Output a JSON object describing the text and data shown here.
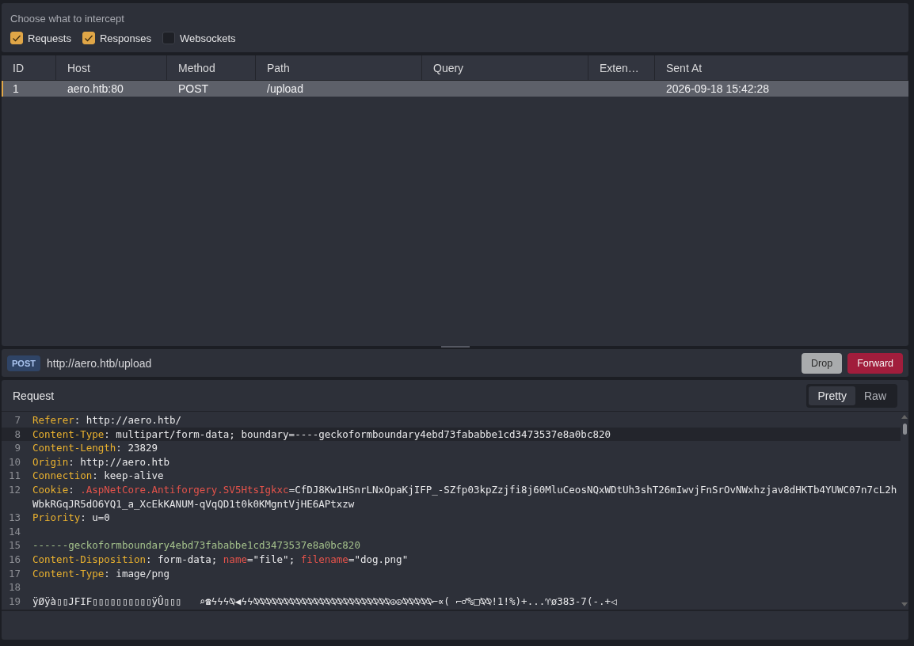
{
  "intercept": {
    "title": "Choose what to intercept",
    "options": [
      {
        "label": "Requests",
        "checked": true
      },
      {
        "label": "Responses",
        "checked": true
      },
      {
        "label": "Websockets",
        "checked": false
      }
    ]
  },
  "table": {
    "columns": [
      "ID",
      "Host",
      "Method",
      "Path",
      "Query",
      "Exten…",
      "Sent At"
    ],
    "rows": [
      {
        "selected": true,
        "cells": [
          "1",
          "aero.htb:80",
          "POST",
          "/upload",
          "",
          "",
          "2026-09-18 15:42:28"
        ]
      }
    ]
  },
  "url_bar": {
    "method": "POST",
    "url": "http://aero.htb/upload",
    "buttons": [
      {
        "label": "Drop",
        "kind": "secondary"
      },
      {
        "label": "Forward",
        "kind": "primary"
      }
    ]
  },
  "request": {
    "title": "Request",
    "tabs": [
      {
        "label": "Pretty",
        "selected": true
      },
      {
        "label": "Raw",
        "selected": false
      }
    ],
    "lines": [
      {
        "number": "7",
        "highlighted": false,
        "segments": [
          {
            "kind": "key",
            "text": "Referer"
          },
          {
            "kind": "plain",
            "text": ": http://aero.htb/"
          }
        ]
      },
      {
        "number": "8",
        "highlighted": true,
        "segments": [
          {
            "kind": "key",
            "text": "Content-Type"
          },
          {
            "kind": "plain",
            "text": ": multipart/form-data; boundary=----geckoformboundary4ebd73fababbe1cd3473537e8a0bc820"
          }
        ]
      },
      {
        "number": "9",
        "highlighted": false,
        "segments": [
          {
            "kind": "key",
            "text": "Content-Length"
          },
          {
            "kind": "plain",
            "text": ": 23829"
          }
        ]
      },
      {
        "number": "10",
        "highlighted": false,
        "segments": [
          {
            "kind": "key",
            "text": "Origin"
          },
          {
            "kind": "plain",
            "text": ": http://aero.htb"
          }
        ]
      },
      {
        "number": "11",
        "highlighted": false,
        "segments": [
          {
            "kind": "key",
            "text": "Connection"
          },
          {
            "kind": "plain",
            "text": ": keep-alive"
          }
        ]
      },
      {
        "number": "12",
        "highlighted": false,
        "segments": [
          {
            "kind": "key",
            "text": "Cookie"
          },
          {
            "kind": "plain",
            "text": ": "
          },
          {
            "kind": "attr",
            "text": ".AspNetCore.Antiforgery.SV5HtsIgkxc"
          },
          {
            "kind": "plain",
            "text": "=CfDJ8Kw1HSnrLNxOpaKjIFP_-SZfp03kpZzjfi8j60MluCeosNQxWDtUh3shT26mIwvjFnSrOvNWxhzjav8dHKTb4YUWC07n7cL2hWbkRGqJR5dO6YQ1_a_XcEkKANUM-qVqQD1t0k0KMgntVjHE6APtxzw"
          }
        ]
      },
      {
        "number": "13",
        "highlighted": false,
        "segments": [
          {
            "kind": "key",
            "text": "Priority"
          },
          {
            "kind": "plain",
            "text": ": u=0"
          }
        ]
      },
      {
        "number": "14",
        "highlighted": false
      },
      {
        "number": "15",
        "highlighted": false,
        "segments": [
          {
            "kind": "boundary",
            "text": "------geckoformboundary4ebd73fababbe1cd3473537e8a0bc820"
          }
        ]
      },
      {
        "number": "16",
        "highlighted": false,
        "segments": [
          {
            "kind": "key",
            "text": "Content-Disposition"
          },
          {
            "kind": "plain",
            "text": ": form-data; "
          },
          {
            "kind": "attr",
            "text": "name"
          },
          {
            "kind": "plain",
            "text": "=\"file\"; "
          },
          {
            "kind": "attr",
            "text": "filename"
          },
          {
            "kind": "plain",
            "text": "=\"dog.png\""
          }
        ]
      },
      {
        "number": "17",
        "highlighted": false,
        "segments": [
          {
            "kind": "key",
            "text": "Content-Type"
          },
          {
            "kind": "plain",
            "text": ": image/png"
          }
        ]
      },
      {
        "number": "18",
        "highlighted": false
      },
      {
        "number": "19",
        "highlighted": false,
        "segments": [
          {
            "kind": "plain",
            "text": "ÿØÿà▯▯JFIF▯▯▯▯▯▯▯▯▯▯ÿÛ▯▯▯   ⌕☎ϟϟϟ⍉◀ϟϟ⍉⍉⍉⍉⍉⍉⍉⍉⍉⍉⍉⍉⍉⍉⍉⍉⍉⍉⍉⍉⍉⍉⍉☮☮⍉⍉⍉⍉⍉⌐∝( ⌐♂%□⍉⍉!1!%)+...♈ø383-7(-.+◁"
          }
        ]
      }
    ]
  }
}
